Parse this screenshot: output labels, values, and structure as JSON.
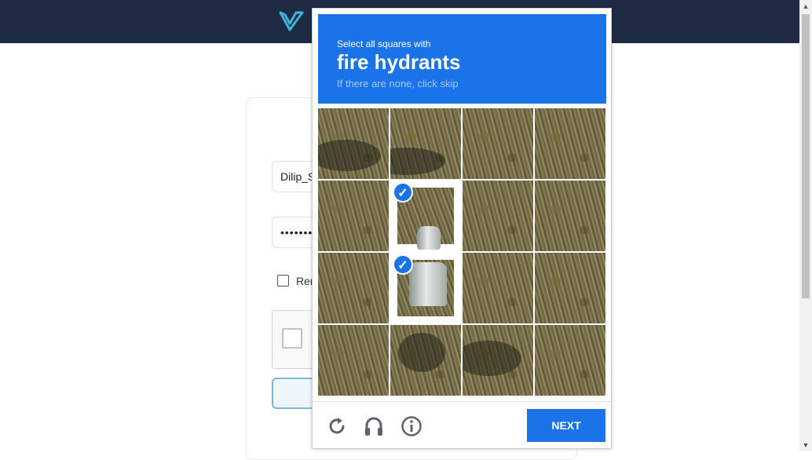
{
  "login_form": {
    "username_value": "Dilip_S",
    "password_value": "•••••••",
    "remember_label": "Rer"
  },
  "captcha": {
    "instruction": "Select all squares with",
    "target": "fire hydrants",
    "hint": "If there are none, click skip",
    "next_label": "NEXT",
    "selected_tiles": [
      5,
      9
    ],
    "icons": [
      "reload-icon",
      "audio-icon",
      "info-icon"
    ],
    "accent_color": "#1a73e8"
  },
  "header": {
    "logo": "v-logo-icon",
    "background": "#1f2a44"
  }
}
